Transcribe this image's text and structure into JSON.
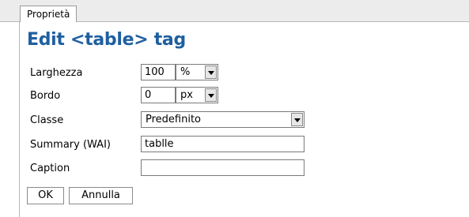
{
  "tabs": [
    {
      "label": "Proprietà",
      "active": true
    }
  ],
  "dialog": {
    "title": "Edit <table> tag"
  },
  "form": {
    "width": {
      "label": "Larghezza",
      "value": "100",
      "unit": "%"
    },
    "border": {
      "label": "Bordo",
      "value": "0",
      "unit": "px"
    },
    "class": {
      "label": "Classe",
      "value": "Predefinito"
    },
    "summary": {
      "label": "Summary (WAI)",
      "value": "tablle"
    },
    "caption": {
      "label": "Caption",
      "value": ""
    }
  },
  "buttons": {
    "ok": "OK",
    "cancel": "Annulla"
  },
  "colors": {
    "title": "#1f5fa0",
    "tabbar": "#ececec"
  }
}
